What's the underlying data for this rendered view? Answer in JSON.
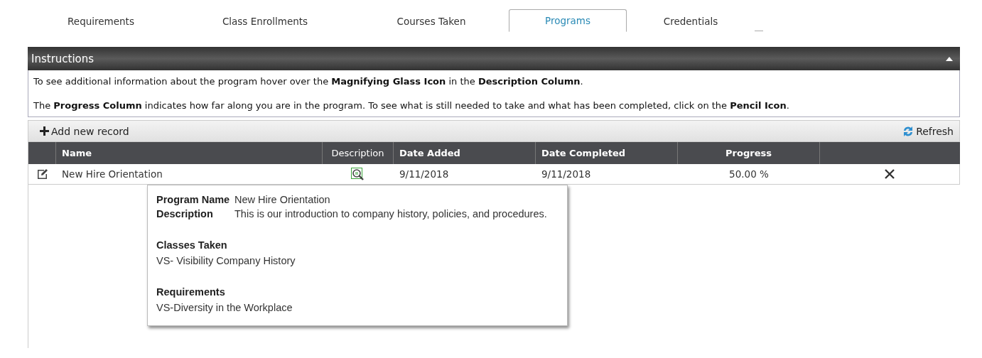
{
  "tabs": [
    {
      "label": "Requirements",
      "selected": false
    },
    {
      "label": "Class Enrollments",
      "selected": false
    },
    {
      "label": "Courses Taken",
      "selected": false
    },
    {
      "label": "Programs",
      "selected": true
    },
    {
      "label": "Credentials",
      "selected": false
    }
  ],
  "instructions": {
    "title": "Instructions",
    "expanded": true,
    "paragraphs": [
      "To see additional information about the program hover over the **Magnifying Glass Icon** in the **Description Column**.",
      "The **Progress Column** indicates how far along you are in the program.  To see what is still needed to take and what has been completed, click on the **Pencil Icon**."
    ]
  },
  "toolbar": {
    "add": "Add new record",
    "refresh": "Refresh"
  },
  "table": {
    "columns": [
      "Name",
      "Description",
      "Date Added",
      "Date Completed",
      "Progress"
    ],
    "rows": [
      {
        "name": "New Hire Orientation",
        "date_added": "9/11/2018",
        "date_completed": "9/11/2018",
        "progress": "50.00 %"
      }
    ]
  },
  "tooltip": {
    "fields": [
      {
        "label": "Program Name",
        "value": "New Hire Orientation"
      },
      {
        "label": "Description",
        "value": "This is our introduction to company history, policies, and procedures."
      }
    ],
    "sections": [
      {
        "heading": "Classes Taken",
        "items": [
          "VS- Visibility Company History"
        ]
      },
      {
        "heading": "Requirements",
        "items": [
          "VS-Diversity in the Workplace"
        ]
      }
    ]
  }
}
